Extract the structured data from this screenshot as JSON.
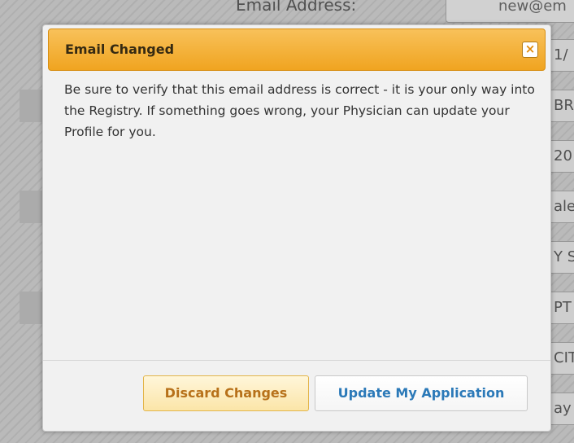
{
  "background": {
    "email_label": "Email Address:",
    "email_value": "new@em",
    "fields": [
      "1/",
      "BR",
      "20",
      "ale",
      "Y S",
      "PT",
      "CIT",
      "ay"
    ]
  },
  "dialog": {
    "title": "Email Changed",
    "close_glyph": "×",
    "message": "Be sure to verify that this email address is correct - it is your only way into the Registry. If something goes wrong, your Physician can update your Profile for you.",
    "buttons": {
      "discard": "Discard Changes",
      "update": "Update My Application"
    }
  },
  "colors": {
    "titlebar": "#f0a420",
    "discard_text": "#b7711a",
    "update_text": "#2b79b8"
  }
}
